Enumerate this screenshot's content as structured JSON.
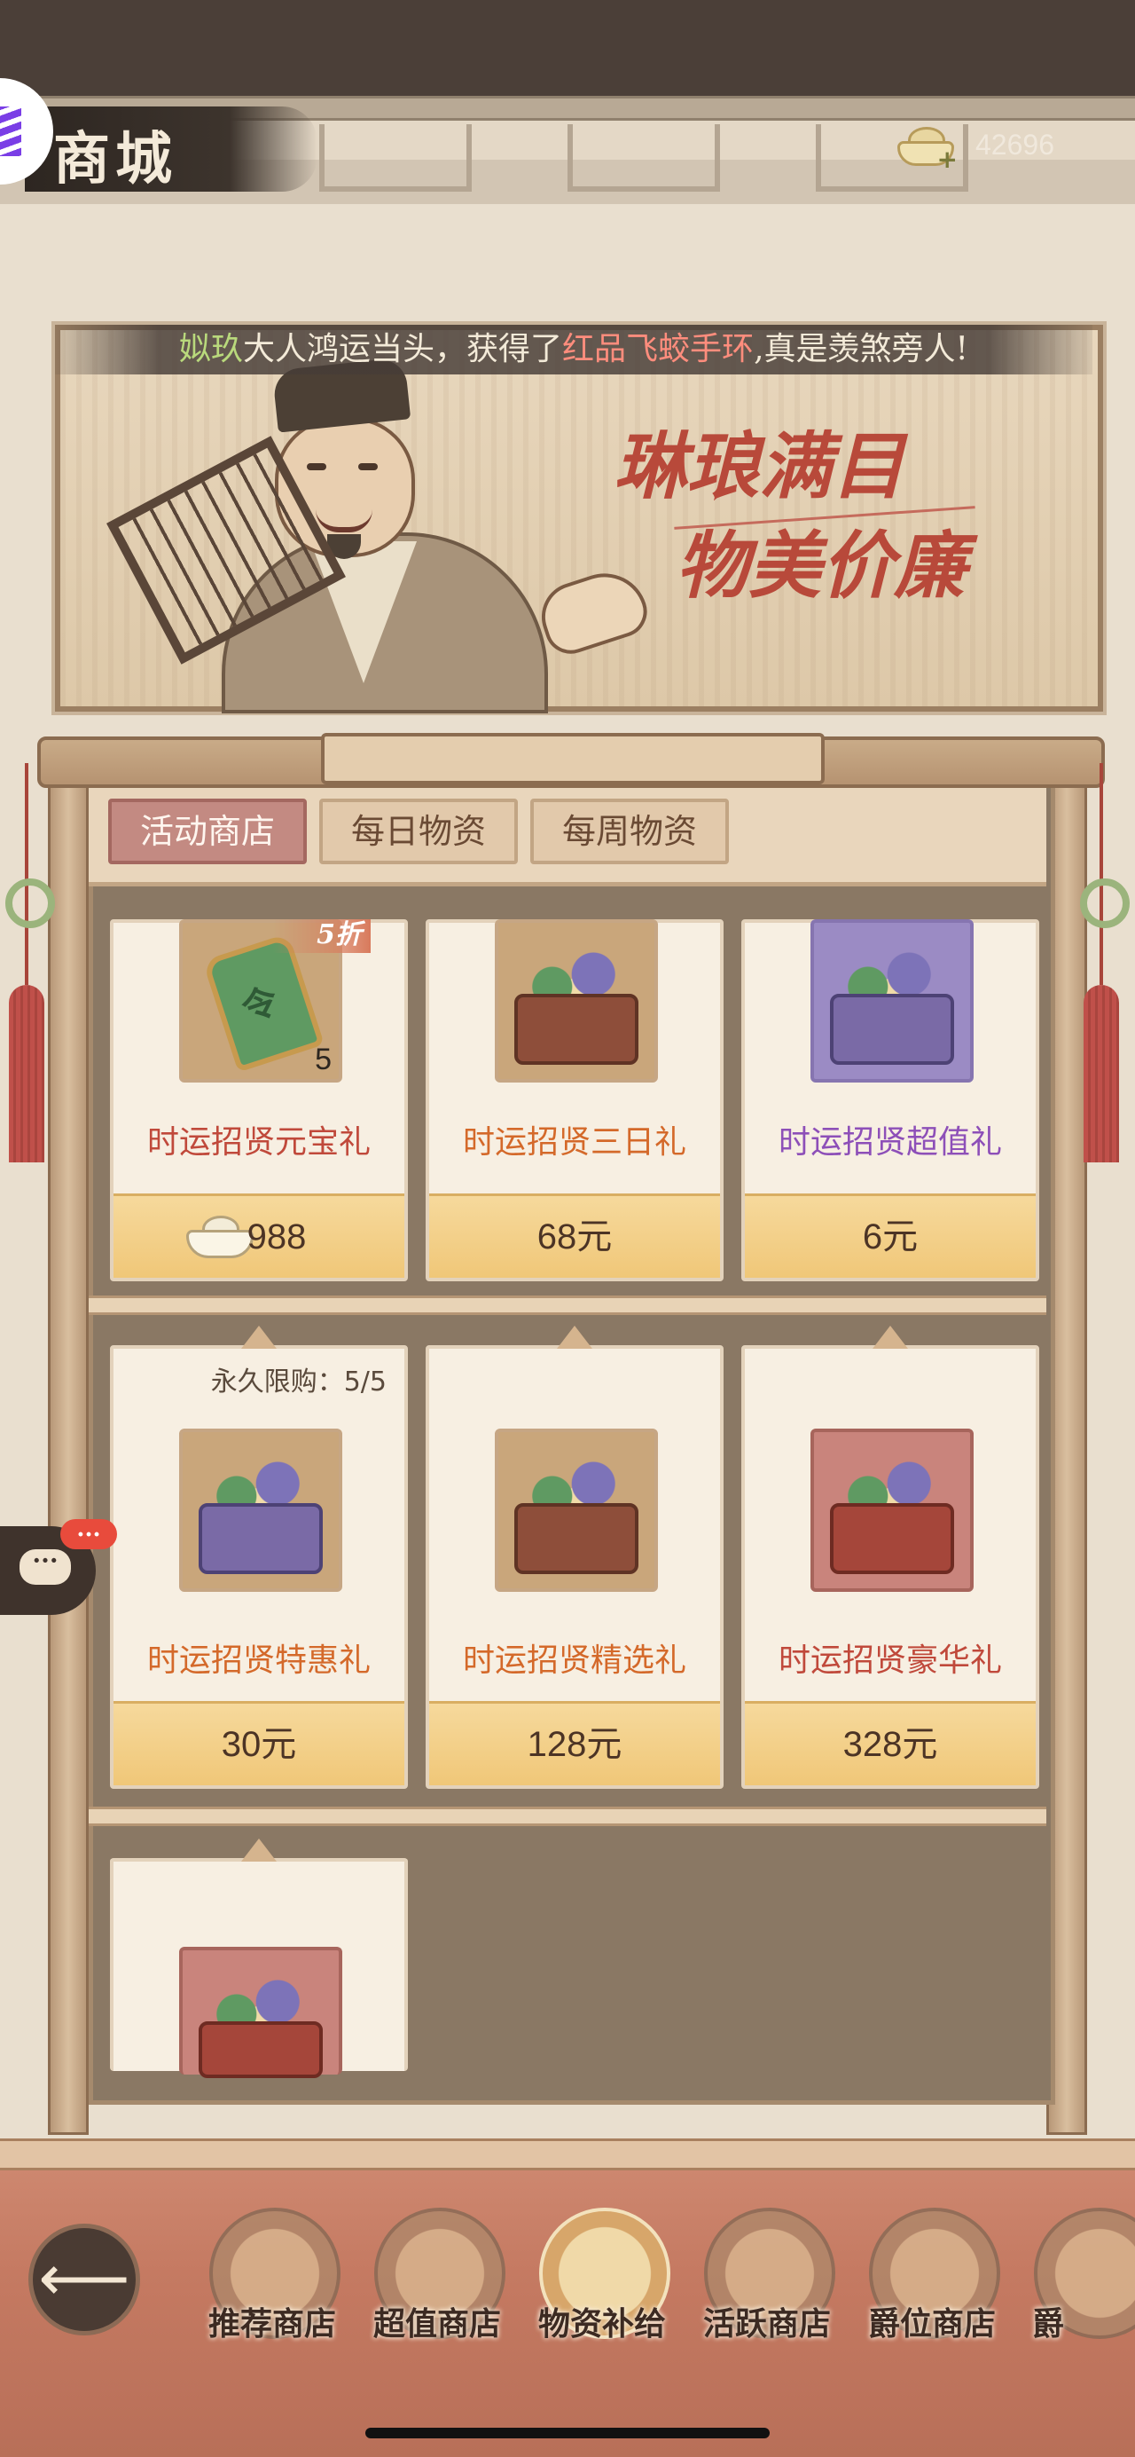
{
  "header": {
    "title": "商城",
    "currency_value": "42696",
    "currency_icon": "silver-ingot-icon"
  },
  "banner": {
    "ticker": {
      "player": "姒玖",
      "text1": "大人鸿运当头，获得了",
      "item": "红品飞蛟手环",
      "text2": ",真是羡煞旁人!"
    },
    "slogan_line1": "琳琅满目",
    "slogan_line2": "物美价廉"
  },
  "tabs": [
    {
      "label": "活动商店",
      "active": true
    },
    {
      "label": "每日物资",
      "active": false
    },
    {
      "label": "每周物资",
      "active": false
    }
  ],
  "products": [
    {
      "name": "时运招贤元宝礼",
      "price": "988",
      "price_currency": "silver-ingot",
      "badge": "5折",
      "item_count": "5",
      "name_color": "#c0493b"
    },
    {
      "name": "时运招贤三日礼",
      "price": "68元",
      "name_color": "#d4692a"
    },
    {
      "name": "时运招贤超值礼",
      "price": "6元",
      "name_color": "#8d4fb8"
    },
    {
      "name": "时运招贤特惠礼",
      "price": "30元",
      "limit": "永久限购：5/5",
      "name_color": "#d4692a"
    },
    {
      "name": "时运招贤精选礼",
      "price": "128元",
      "name_color": "#d4692a"
    },
    {
      "name": "时运招贤豪华礼",
      "price": "328元",
      "name_color": "#c0493b"
    },
    {
      "name": "",
      "price": ""
    }
  ],
  "chat": {
    "badge": "...",
    "icon": "chat-bubble-icon"
  },
  "bottom_nav": [
    {
      "label": "推荐商店",
      "active": false
    },
    {
      "label": "超值商店",
      "active": false
    },
    {
      "label": "物资补给",
      "active": true
    },
    {
      "label": "活跃商店",
      "active": false
    },
    {
      "label": "爵位商店",
      "active": false
    },
    {
      "label": "爵",
      "active": false
    }
  ],
  "colors": {
    "tab_active": "#c38a82",
    "price_bar": "#f0c778",
    "nav_bg": "#c57a62"
  }
}
